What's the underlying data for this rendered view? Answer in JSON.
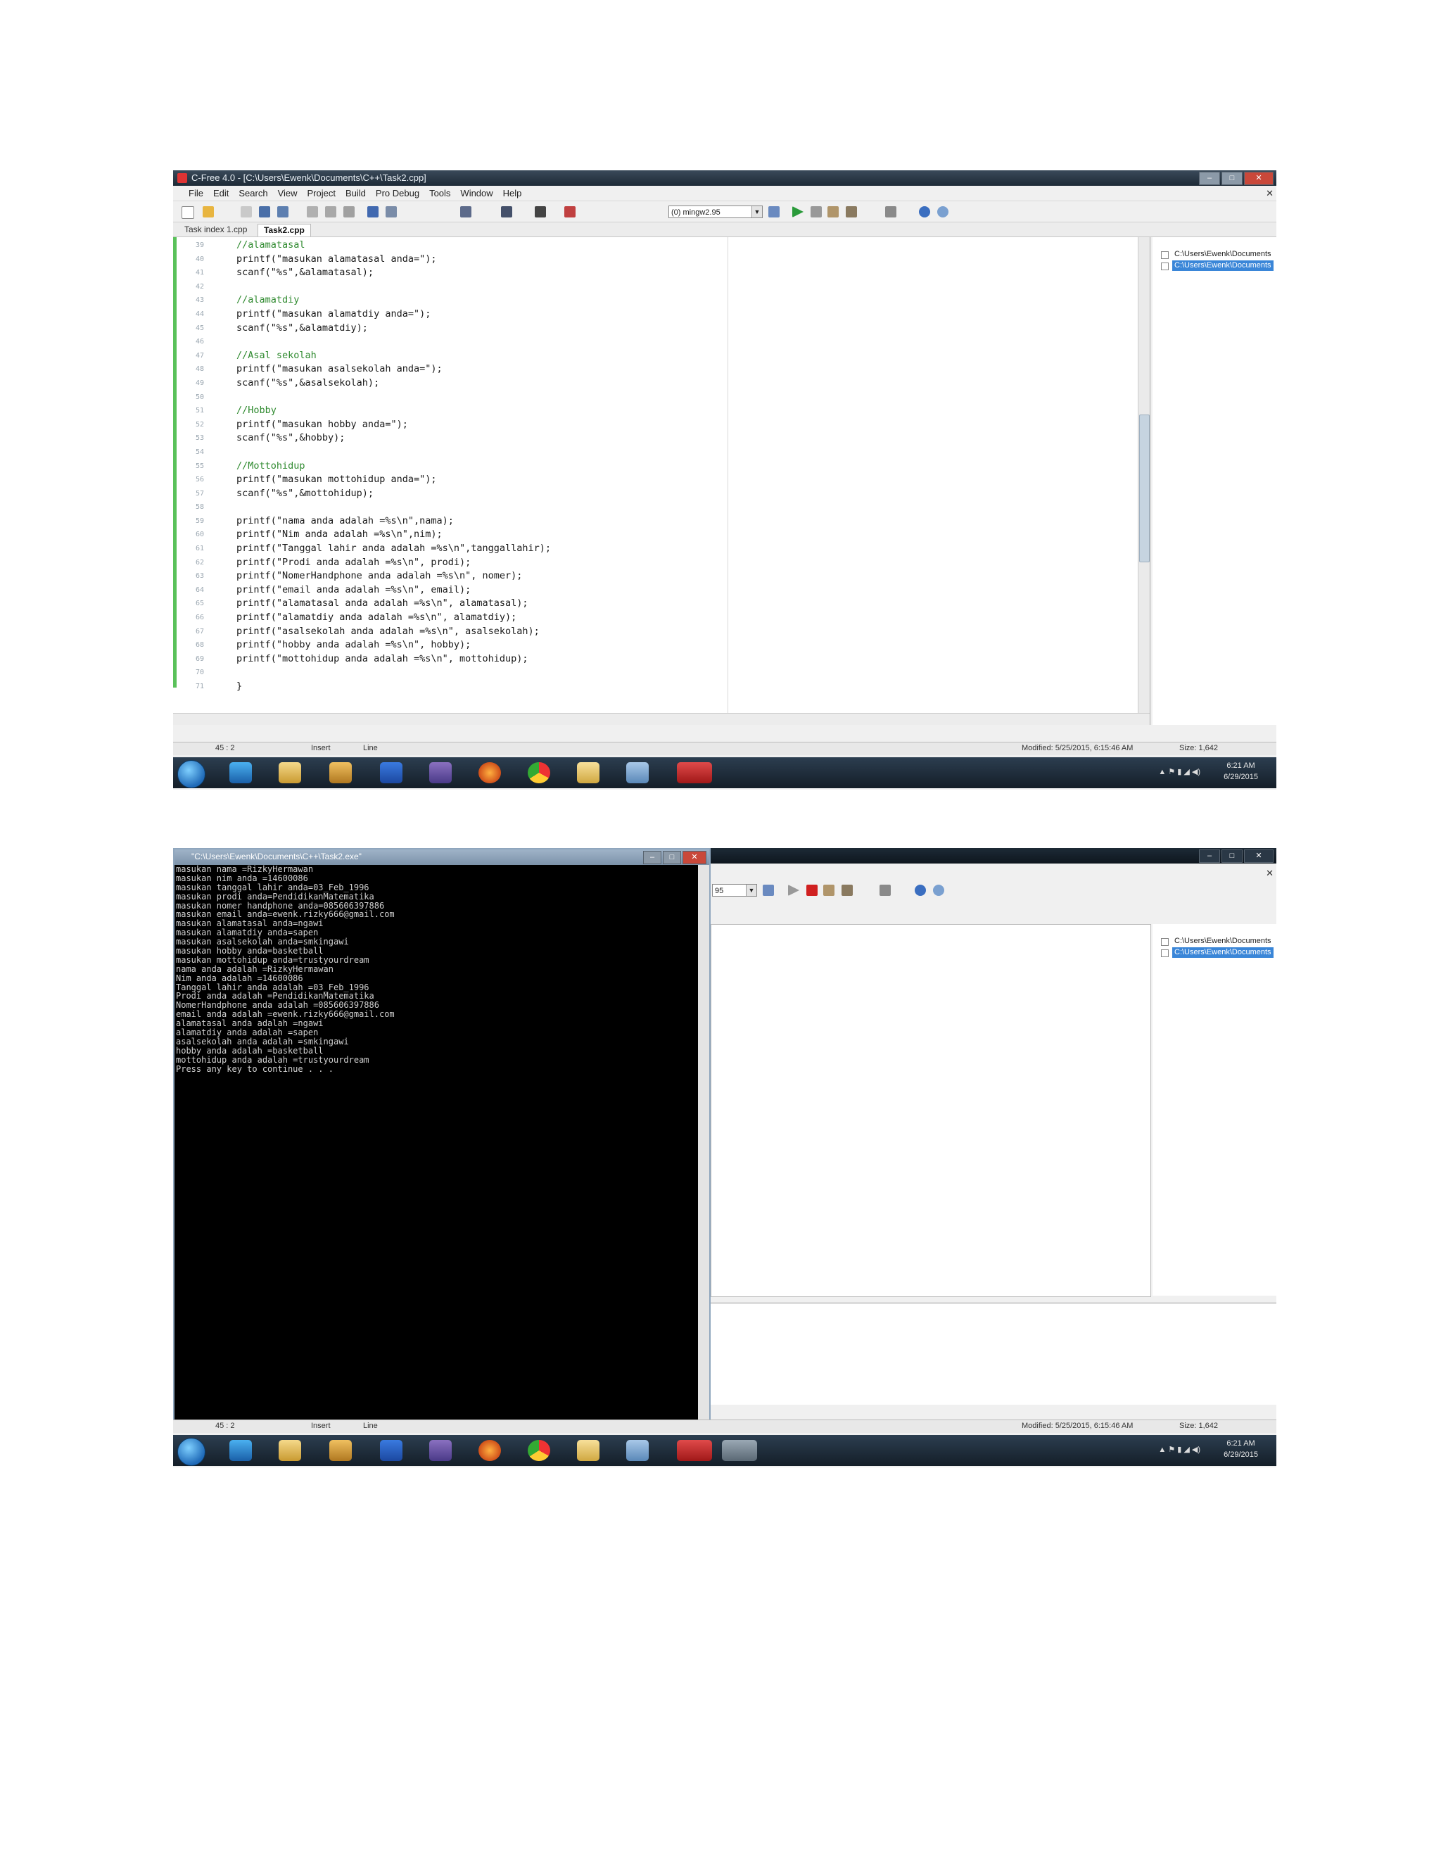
{
  "ide": {
    "title": "C-Free 4.0 - [C:\\Users\\Ewenk\\Documents\\C++\\Task2.cpp]",
    "menu": [
      "File",
      "Edit",
      "Search",
      "View",
      "Project",
      "Build",
      "Pro Debug",
      "Tools",
      "Window",
      "Help"
    ],
    "compiler_combo": "(0) mingw2.95",
    "tabs": [
      "Task index 1.cpp",
      "Task2.cpp"
    ],
    "code_lines": [
      {
        "n": "39",
        "t": "//alamatasal",
        "k": "cmt"
      },
      {
        "n": "40",
        "t": "printf(\"masukan alamatasal anda=\");",
        "k": "code"
      },
      {
        "n": "41",
        "t": "scanf(\"%s\",&alamatasal);",
        "k": "code"
      },
      {
        "n": "42",
        "t": "",
        "k": "code"
      },
      {
        "n": "43",
        "t": "//alamatdiy",
        "k": "cmt"
      },
      {
        "n": "44",
        "t": "printf(\"masukan alamatdiy anda=\");",
        "k": "code"
      },
      {
        "n": "45",
        "t": "scanf(\"%s\",&alamatdiy);",
        "k": "code"
      },
      {
        "n": "46",
        "t": "",
        "k": "code"
      },
      {
        "n": "47",
        "t": "//Asal sekolah",
        "k": "cmt"
      },
      {
        "n": "48",
        "t": "printf(\"masukan asalsekolah anda=\");",
        "k": "code"
      },
      {
        "n": "49",
        "t": "scanf(\"%s\",&asalsekolah);",
        "k": "code"
      },
      {
        "n": "50",
        "t": "",
        "k": "code"
      },
      {
        "n": "51",
        "t": "//Hobby",
        "k": "cmt"
      },
      {
        "n": "52",
        "t": "printf(\"masukan hobby anda=\");",
        "k": "code"
      },
      {
        "n": "53",
        "t": "scanf(\"%s\",&hobby);",
        "k": "code"
      },
      {
        "n": "54",
        "t": "",
        "k": "code"
      },
      {
        "n": "55",
        "t": "//Mottohidup",
        "k": "cmt"
      },
      {
        "n": "56",
        "t": "printf(\"masukan mottohidup anda=\");",
        "k": "code"
      },
      {
        "n": "57",
        "t": "scanf(\"%s\",&mottohidup);",
        "k": "code"
      },
      {
        "n": "58",
        "t": "",
        "k": "code"
      },
      {
        "n": "59",
        "t": "printf(\"nama anda adalah =%s\\n\",nama);",
        "k": "code"
      },
      {
        "n": "60",
        "t": "printf(\"Nim anda adalah =%s\\n\",nim);",
        "k": "code"
      },
      {
        "n": "61",
        "t": "printf(\"Tanggal lahir anda adalah =%s\\n\",tanggallahir);",
        "k": "code"
      },
      {
        "n": "62",
        "t": "printf(\"Prodi anda adalah =%s\\n\", prodi);",
        "k": "code"
      },
      {
        "n": "63",
        "t": "printf(\"NomerHandphone anda adalah =%s\\n\", nomer);",
        "k": "code"
      },
      {
        "n": "64",
        "t": "printf(\"email anda adalah =%s\\n\", email);",
        "k": "code"
      },
      {
        "n": "65",
        "t": "printf(\"alamatasal anda adalah =%s\\n\", alamatasal);",
        "k": "code"
      },
      {
        "n": "66",
        "t": "printf(\"alamatdiy anda adalah =%s\\n\", alamatdiy);",
        "k": "code"
      },
      {
        "n": "67",
        "t": "printf(\"asalsekolah anda adalah =%s\\n\", asalsekolah);",
        "k": "code"
      },
      {
        "n": "68",
        "t": "printf(\"hobby anda adalah =%s\\n\", hobby);",
        "k": "code"
      },
      {
        "n": "69",
        "t": "printf(\"mottohidup anda adalah =%s\\n\", mottohidup);",
        "k": "code"
      },
      {
        "n": "70",
        "t": "",
        "k": "code"
      },
      {
        "n": "71",
        "t": "}",
        "k": "code"
      }
    ],
    "tree": [
      "C:\\Users\\Ewenk\\Documents",
      "C:\\Users\\Ewenk\\Documents"
    ],
    "status": {
      "position": "45 : 2",
      "mode": "Insert",
      "line_label": "Line",
      "modified": "Modified: 5/25/2015, 6:15:46 AM",
      "size": "Size: 1,642"
    },
    "clock_time": "6:21 AM",
    "clock_date": "6/29/2015"
  },
  "console": {
    "title": "\"C:\\Users\\Ewenk\\Documents\\C++\\Task2.exe\"",
    "lines": [
      "masukan nama =RizkyHermawan",
      "masukan nim anda =14600086",
      "masukan tanggal lahir anda=03_Feb_1996",
      "masukan prodi anda=PendidikanMatematika",
      "masukan nomer handphone anda=085606397886",
      "masukan email anda=ewenk.rizky666@gmail.com",
      "masukan alamatasal anda=ngawi",
      "masukan alamatdiy anda=sapen",
      "masukan asalsekolah anda=smkingawi",
      "masukan hobby anda=basketball",
      "masukan mottohidup anda=trustyourdream",
      "nama anda adalah =RizkyHermawan",
      "Nim anda adalah =14600086",
      "Tanggal lahir anda adalah =03_Feb_1996",
      "Prodi anda adalah =PendidikanMatematika",
      "NomerHandphone anda adalah =085606397886",
      "email anda adalah =ewenk.rizky666@gmail.com",
      "alamatasal anda adalah =ngawi",
      "alamatdiy anda adalah =sapen",
      "asalsekolah anda adalah =smkingawi",
      "hobby anda adalah =basketball",
      "mottohidup anda adalah =trustyourdream",
      "Press any key to continue . . ."
    ],
    "bg_combo": "95",
    "status": {
      "position": "45 : 2",
      "mode": "Insert",
      "line_label": "Line",
      "modified": "Modified: 5/25/2015, 6:15:46 AM",
      "size": "Size: 1,642"
    },
    "clock_time": "6:21 AM",
    "clock_date": "6/29/2015"
  },
  "taskbar_icons": [
    "ie-icon",
    "explorer-icon",
    "media-player-icon",
    "app-icon",
    "vs-icon",
    "firefox-icon",
    "chrome-icon",
    "folder-icon",
    "notepad-icon",
    "cfree-icon"
  ],
  "colors": {
    "comment": "#2f8a2f",
    "console_bg": "#000000",
    "taskbar": "#1d2a36",
    "selection": "#3a86d8"
  }
}
